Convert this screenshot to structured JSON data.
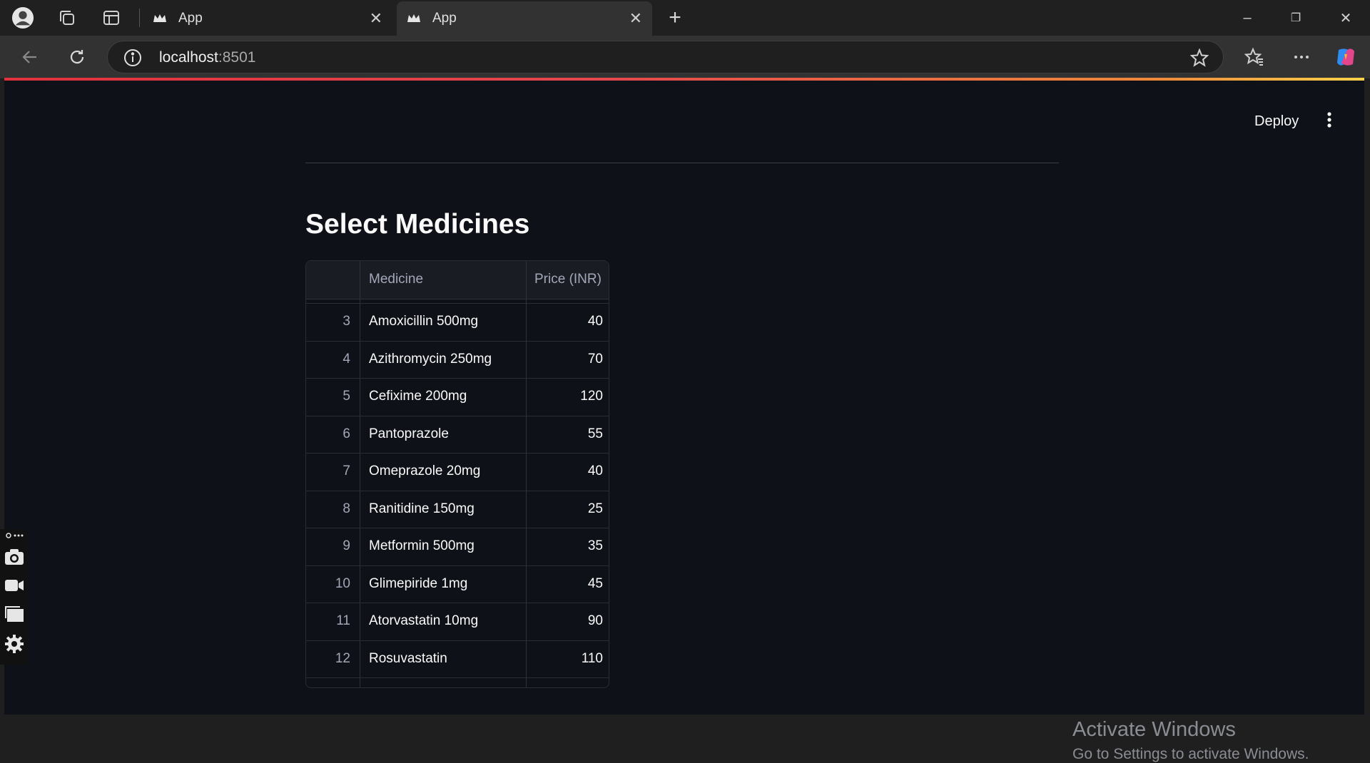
{
  "browser": {
    "tabs": [
      {
        "title": "App",
        "close": "✕"
      },
      {
        "title": "App",
        "close": "✕"
      }
    ],
    "new_tab": "+",
    "url_host": "localhost",
    "url_port": ":8501",
    "window_controls": {
      "minimize": "–",
      "restore": "❐",
      "close": "✕"
    }
  },
  "app": {
    "deploy_label": "Deploy",
    "heading": "Select Medicines",
    "table": {
      "columns": [
        "",
        "Medicine",
        "Price (INR)"
      ],
      "rows": [
        {
          "index": "3",
          "medicine": "Amoxicillin 500mg",
          "price": "40"
        },
        {
          "index": "4",
          "medicine": "Azithromycin 250mg",
          "price": "70"
        },
        {
          "index": "5",
          "medicine": "Cefixime 200mg",
          "price": "120"
        },
        {
          "index": "6",
          "medicine": "Pantoprazole",
          "price": "55"
        },
        {
          "index": "7",
          "medicine": "Omeprazole 20mg",
          "price": "40"
        },
        {
          "index": "8",
          "medicine": "Ranitidine 150mg",
          "price": "25"
        },
        {
          "index": "9",
          "medicine": "Metformin 500mg",
          "price": "35"
        },
        {
          "index": "10",
          "medicine": "Glimepiride 1mg",
          "price": "45"
        },
        {
          "index": "11",
          "medicine": "Atorvastatin 10mg",
          "price": "90"
        },
        {
          "index": "12",
          "medicine": "Rosuvastatin",
          "price": "110"
        }
      ]
    }
  },
  "watermark": {
    "line1": "Activate Windows",
    "line2": "Go to Settings to activate Windows."
  },
  "colors": {
    "page_bg": "#0e1117",
    "chrome_bg": "#202020",
    "toolbar_bg": "#323232",
    "accent_red": "#e5484d"
  }
}
